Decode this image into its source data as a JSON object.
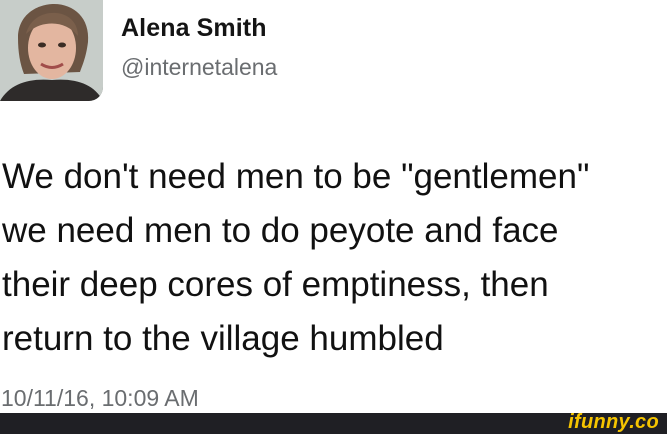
{
  "user": {
    "display_name": "Alena Smith",
    "handle": "@internetalena"
  },
  "tweet": {
    "text": "We don't need men to be \"gentlemen\"\nwe need men to do peyote and face\ntheir deep cores of emptiness, then\nreturn to the village humbled",
    "timestamp": "10/11/16, 10:09 AM"
  },
  "watermark": {
    "label": "ifunny.co",
    "color": "#f5c400"
  }
}
